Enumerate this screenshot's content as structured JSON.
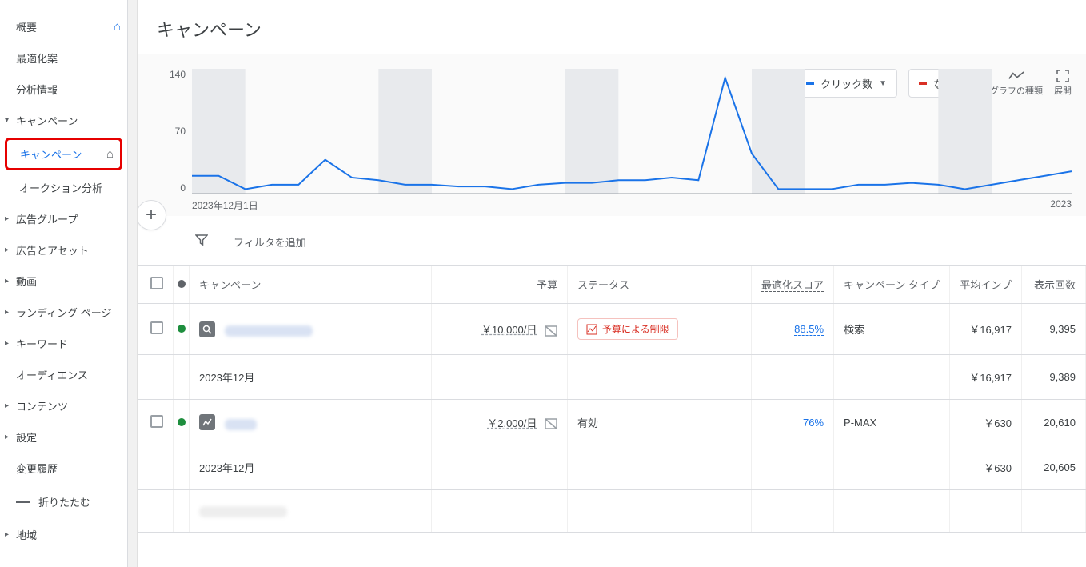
{
  "sidebar": {
    "items": [
      {
        "label": "概要",
        "home": true
      },
      {
        "label": "最適化案"
      },
      {
        "label": "分析情報"
      },
      {
        "label": "キャンペーン",
        "caret": true
      },
      {
        "label": "キャンペーン",
        "highlighted": true,
        "home": true
      },
      {
        "label": "オークション分析"
      },
      {
        "label": "広告グループ",
        "caret": true
      },
      {
        "label": "広告とアセット",
        "caret": true
      },
      {
        "label": "動画",
        "caret": true
      },
      {
        "label": "ランディング ページ",
        "caret": true
      },
      {
        "label": "キーワード",
        "caret": true
      },
      {
        "label": "オーディエンス"
      },
      {
        "label": "コンテンツ",
        "caret": true
      },
      {
        "label": "設定",
        "caret": true
      },
      {
        "label": "変更履歴"
      }
    ],
    "collapse": "折りたたむ",
    "region": "地域"
  },
  "page_title": "キャンペーン",
  "controls": {
    "metric1": "クリック数",
    "metric2": "なし",
    "chart_type": "グラフの種類",
    "expand": "展開"
  },
  "chart_data": {
    "type": "line",
    "ylim": [
      0,
      140
    ],
    "yticks": [
      140,
      70,
      0
    ],
    "x_start_label": "2023年12月1日",
    "x_end_label": "2023",
    "values": [
      20,
      20,
      5,
      10,
      10,
      38,
      18,
      15,
      10,
      10,
      8,
      8,
      5,
      10,
      12,
      12,
      15,
      15,
      18,
      15,
      130,
      45,
      5,
      5,
      5,
      10,
      10,
      12,
      10,
      5,
      10,
      15,
      20,
      25
    ],
    "weekend_bands": [
      [
        0,
        2
      ],
      [
        7,
        9
      ],
      [
        14,
        16
      ],
      [
        21,
        23
      ],
      [
        28,
        30
      ]
    ]
  },
  "filter_placeholder": "フィルタを追加",
  "table": {
    "headers": {
      "campaign": "キャンペーン",
      "budget": "予算",
      "status": "ステータス",
      "score": "最適化スコア",
      "ctype": "キャンペーン タイプ",
      "avg_impr": "平均インプ",
      "views": "表示回数"
    },
    "rows": [
      {
        "type": "data",
        "icon": "search",
        "budget": "￥10,000/日",
        "status": "budget_limited",
        "status_text": "予算による制限",
        "score": "88.5%",
        "ctype": "検索",
        "avg_impr": "￥16,917",
        "views": "9,395"
      },
      {
        "type": "sub",
        "label": "2023年12月",
        "avg_impr": "￥16,917",
        "views": "9,389"
      },
      {
        "type": "data",
        "icon": "pmax",
        "budget": "￥2,000/日",
        "status": "active",
        "status_text": "有効",
        "score": "76%",
        "ctype": "P-MAX",
        "avg_impr": "￥630",
        "views": "20,610"
      },
      {
        "type": "sub",
        "label": "2023年12月",
        "avg_impr": "￥630",
        "views": "20,605"
      }
    ]
  }
}
